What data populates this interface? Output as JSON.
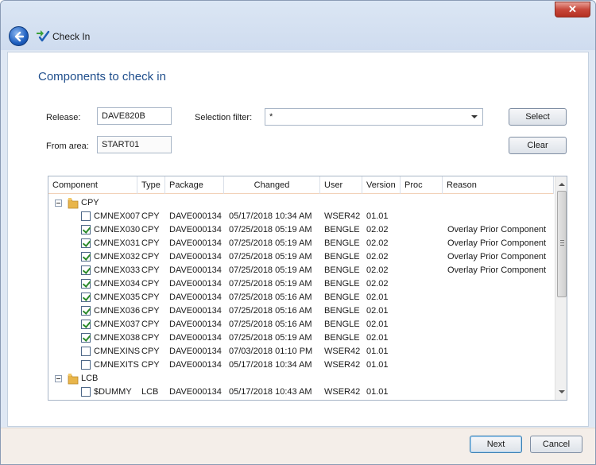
{
  "window": {
    "title": "Check In",
    "close_glyph": "✕"
  },
  "heading": "Components to check in",
  "form": {
    "release_label": "Release:",
    "release_value": "DAVE820B",
    "from_area_label": "From area:",
    "from_area_value": "START01",
    "selection_filter_label": "Selection filter:",
    "selection_filter_value": "*"
  },
  "buttons": {
    "select": "Select",
    "clear": "Clear",
    "next": "Next",
    "cancel": "Cancel"
  },
  "columns": [
    "Component",
    "Type",
    "Package",
    "Changed",
    "User",
    "Version",
    "Proc",
    "Reason"
  ],
  "groups": [
    {
      "name": "CPY",
      "rows": [
        {
          "checked": false,
          "component": "CMNEX007",
          "type": "CPY",
          "package": "DAVE000134",
          "changed": "05/17/2018  10:34 AM",
          "user": "WSER42",
          "version": "01.01",
          "proc": "",
          "reason": ""
        },
        {
          "checked": true,
          "component": "CMNEX030",
          "type": "CPY",
          "package": "DAVE000134",
          "changed": "07/25/2018  05:19 AM",
          "user": "BENGLE",
          "version": "02.02",
          "proc": "",
          "reason": "Overlay Prior Component"
        },
        {
          "checked": true,
          "component": "CMNEX031",
          "type": "CPY",
          "package": "DAVE000134",
          "changed": "07/25/2018  05:19 AM",
          "user": "BENGLE",
          "version": "02.02",
          "proc": "",
          "reason": "Overlay Prior Component"
        },
        {
          "checked": true,
          "component": "CMNEX032",
          "type": "CPY",
          "package": "DAVE000134",
          "changed": "07/25/2018  05:19 AM",
          "user": "BENGLE",
          "version": "02.02",
          "proc": "",
          "reason": "Overlay Prior Component"
        },
        {
          "checked": true,
          "component": "CMNEX033",
          "type": "CPY",
          "package": "DAVE000134",
          "changed": "07/25/2018  05:19 AM",
          "user": "BENGLE",
          "version": "02.02",
          "proc": "",
          "reason": "Overlay Prior Component"
        },
        {
          "checked": true,
          "component": "CMNEX034",
          "type": "CPY",
          "package": "DAVE000134",
          "changed": "07/25/2018  05:19 AM",
          "user": "BENGLE",
          "version": "02.02",
          "proc": "",
          "reason": ""
        },
        {
          "checked": true,
          "component": "CMNEX035",
          "type": "CPY",
          "package": "DAVE000134",
          "changed": "07/25/2018  05:16 AM",
          "user": "BENGLE",
          "version": "02.01",
          "proc": "",
          "reason": ""
        },
        {
          "checked": true,
          "component": "CMNEX036",
          "type": "CPY",
          "package": "DAVE000134",
          "changed": "07/25/2018  05:16 AM",
          "user": "BENGLE",
          "version": "02.01",
          "proc": "",
          "reason": ""
        },
        {
          "checked": true,
          "component": "CMNEX037",
          "type": "CPY",
          "package": "DAVE000134",
          "changed": "07/25/2018  05:16 AM",
          "user": "BENGLE",
          "version": "02.01",
          "proc": "",
          "reason": ""
        },
        {
          "checked": true,
          "component": "CMNEX038",
          "type": "CPY",
          "package": "DAVE000134",
          "changed": "07/25/2018  05:19 AM",
          "user": "BENGLE",
          "version": "02.01",
          "proc": "",
          "reason": ""
        },
        {
          "checked": false,
          "component": "CMNEXINS",
          "type": "CPY",
          "package": "DAVE000134",
          "changed": "07/03/2018  01:10 PM",
          "user": "WSER42",
          "version": "01.01",
          "proc": "",
          "reason": ""
        },
        {
          "checked": false,
          "component": "CMNEXITS",
          "type": "CPY",
          "package": "DAVE000134",
          "changed": "05/17/2018  10:34 AM",
          "user": "WSER42",
          "version": "01.01",
          "proc": "",
          "reason": ""
        }
      ]
    },
    {
      "name": "LCB",
      "rows": [
        {
          "checked": false,
          "component": "$DUMMY",
          "type": "LCB",
          "package": "DAVE000134",
          "changed": "05/17/2018  10:43 AM",
          "user": "WSER42",
          "version": "01.01",
          "proc": "",
          "reason": ""
        }
      ]
    }
  ],
  "colors": {
    "heading": "#1f4e8c",
    "check": "#2a8a2a",
    "folder": "#e8b54a"
  }
}
